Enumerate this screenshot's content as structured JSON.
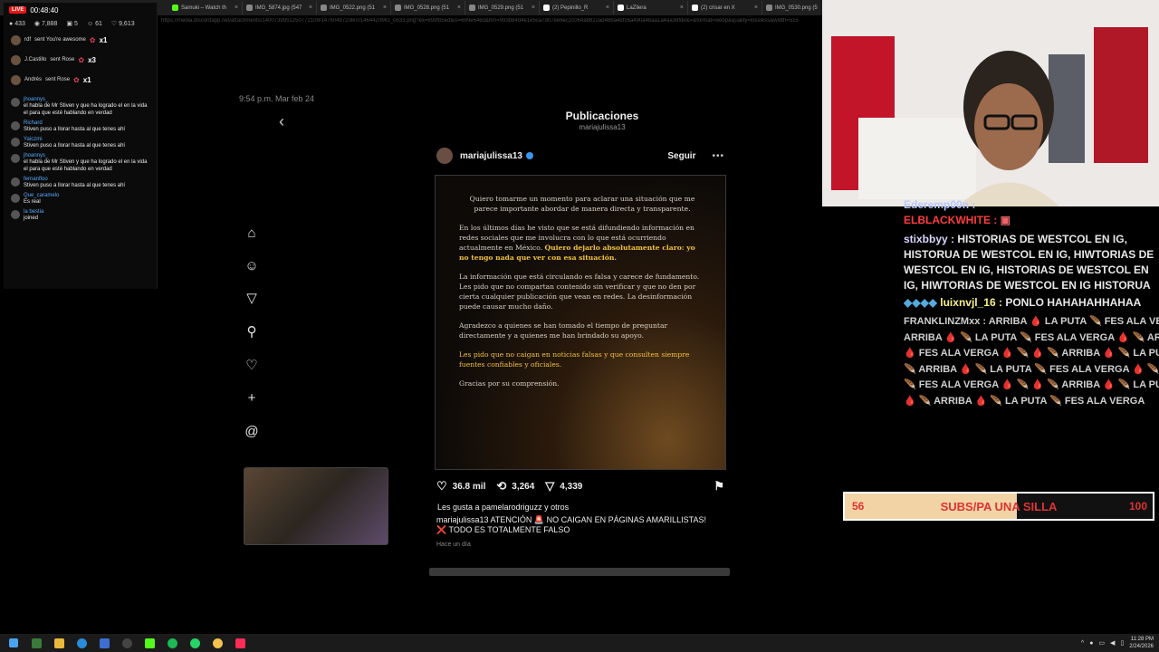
{
  "browser": {
    "tabs": [
      {
        "title": "Samuki – Watch th",
        "color": "#53fc18"
      },
      {
        "title": "IMG_5874.jpg (547",
        "color": "#888888"
      },
      {
        "title": "IMG_0522.png (51",
        "color": "#888888"
      },
      {
        "title": "IMG_0528.png (51",
        "color": "#888888"
      },
      {
        "title": "IMG_0529.png (51",
        "color": "#888888"
      },
      {
        "title": "(2) Pepinillo_R",
        "color": "#ffffff"
      },
      {
        "title": "LaZilera",
        "color": "#ffffff"
      },
      {
        "title": "(2) crisar en X",
        "color": "#ffffff"
      },
      {
        "title": "IMG_0530.png (5",
        "color": "#888888"
      }
    ],
    "url": "https://media.discordapp.net/attachments/1400739951250772109/1476049723600146442/IMG_0533.png?ex=699fb5ed&is=699e646d&hm=993b84d4e1e5ca7d07ee6ec2c064a8822ad46ba4bf16a490a4baa1a4aa38fde&=&format=webp&quality=lossless&width=515"
  },
  "stream_chat": {
    "live": "LIVE",
    "timer": "00:48:40",
    "stats": [
      "433",
      "7,888",
      "5",
      "61",
      "9,613"
    ],
    "gifts": [
      {
        "user": "rdf",
        "text": "sent You're awesome",
        "count": "x1"
      },
      {
        "user": "J.Castillo",
        "text": "sent Rose",
        "count": "x3"
      },
      {
        "user": "Andrés",
        "text": "sent Rose",
        "count": "x1"
      }
    ],
    "messages": [
      {
        "user": "jhoannys_",
        "text": "el habla de Mr Stiven y que ha logrado el en la vida el para que esté hablando en verdad"
      },
      {
        "user": "Richard",
        "text": "Stiven puso a llorar hasta al que tenes ahí"
      },
      {
        "user": "Yaiczmi",
        "text": "Stiven puso a llorar hasta al que tenes ahí"
      },
      {
        "user": "jhoannys_",
        "text": "el habla de Mr Stiven y que ha logrado el en la vida el para que esté hablando en verdad"
      },
      {
        "user": "fernanfloo",
        "text": "Stiven puso a llorar hasta al que tenes ahí"
      },
      {
        "user": "Que_caramelo",
        "text": "Es real"
      },
      {
        "user": "la bestia",
        "text": "joined"
      }
    ]
  },
  "instagram": {
    "timestamp": "9:54 p.m.  Mar feb 24",
    "header_title": "Publicaciones",
    "header_subtitle": "mariajulissa13",
    "username": "mariajulissa13",
    "follow_label": "Seguir",
    "post_text": {
      "p1": "Quiero tomarme un momento para aclarar una situación que me parece importante abordar de manera directa y transparente.",
      "p2a": "En los últimos días he visto que se está difundiendo información en redes sociales que me involucra con lo que está ocurriendo actualmente en México.",
      "p2b": "Quiero dejarlo absolutamente claro: yo no tengo nada que ver con esa situación.",
      "p3": "La información que está circulando es falsa y carece de fundamento. Les pido que no compartan contenido sin verificar y que no den por cierta cualquier publicación que vean en redes. La desinformación puede causar mucho daño.",
      "p4": "Agradezco a quienes se han tomado el tiempo de preguntar directamente y a quienes me han brindado su apoyo.",
      "p5": "Les pido que no caigan en noticias falsas y que consulten siempre fuentes confiables y oficiales.",
      "p6": "Gracias por su comprensión."
    },
    "likes": "36.8 mil",
    "reposts": "3,264",
    "shares": "4,339",
    "liked_by": "Les gusta a pamelarodriguzz y otros",
    "caption": "mariajulissa13 ATENCIÓN 🚨 NO CAIGAN EN PÁGINAS AMARILLISTAS! ❌ TODO ES TOTALMENTE FALSO",
    "time_ago": "Hace un día"
  },
  "right_chat": {
    "line0": "Ederemp00n :",
    "line1_user": "ELBLACKWHITE :",
    "line2_user": "stixbbyy :",
    "line2_text": "HISTORIAS DE WESTCOL EN IG, HISTORUA DE WESTCOL EN IG, HIWTORIAS DE WESTCOL EN IG, HISTORIAS DE WESTCOL EN IG, HIWTORIAS DE WESTCOL EN IG HISTORUA DE WESTCOL EN IG, HIWTORIAS DE WEST",
    "line3_user": "luixnvjl_16 :",
    "line3_text": "PONLO HAHAHAHHAHAA",
    "line4_user": "FRANKLINZMxx :",
    "spam": [
      "FRANKLINZMxx : ARRIBA 🩸 LA PUTA 🪶 FES ALA VERGA",
      "ARRIBA 🩸 🪶 LA PUTA 🪶 FES ALA VERGA 🩸 🪶 ARRIBA",
      "🩸 FES ALA VERGA 🩸 🪶 🩸 🪶 ARRIBA 🩸 🪶 LA PUTA",
      "🪶 ARRIBA 🩸 🪶 LA PUTA 🪶 FES ALA VERGA 🩸 🪶",
      "🪶 FES ALA VERGA 🩸 🪶 🩸 🪶 ARRIBA 🩸 🪶 LA PUT",
      "🩸 🪶 ARRIBA 🩸 🪶 LA PUTA 🪶 FES ALA VERGA"
    ]
  },
  "goal": {
    "from": "56",
    "label": "SUBS/PA UNA SILLA",
    "to": "100",
    "fill_percent": 56
  },
  "taskbar": {
    "time": "11:28 PM",
    "date": "2/24/2026"
  }
}
